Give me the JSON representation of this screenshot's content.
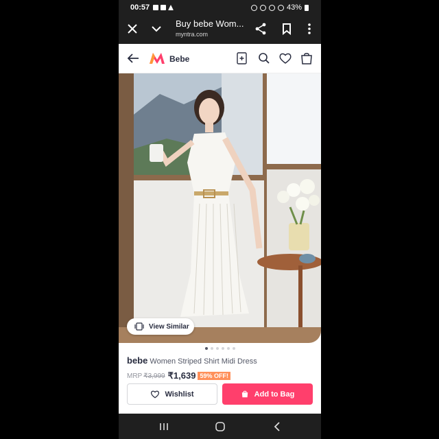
{
  "status_bar": {
    "time": "00:57",
    "battery": "43%"
  },
  "browser": {
    "title": "Buy bebe Wom...",
    "url": "myntra.com"
  },
  "app_header": {
    "brand": "Bebe",
    "icons": [
      "back-arrow-icon",
      "myntra-logo",
      "add-to-home-icon",
      "search-icon",
      "heart-icon",
      "bag-icon"
    ]
  },
  "product": {
    "view_similar_label": "View Similar",
    "carousel": {
      "total": 6,
      "active_index": 0
    },
    "brand_name": "bebe",
    "title": "Women Striped Shirt Midi Dress",
    "mrp_label": "MRP",
    "mrp": "₹3,999",
    "price": "₹1,639",
    "discount": "59% OFF!"
  },
  "actions": {
    "wishlist_label": "Wishlist",
    "bag_label": "Add to Bag"
  },
  "colors": {
    "accent": "#ff3f6c",
    "discount_bg": "#ff905a",
    "system_bar": "#1f1f1f"
  }
}
